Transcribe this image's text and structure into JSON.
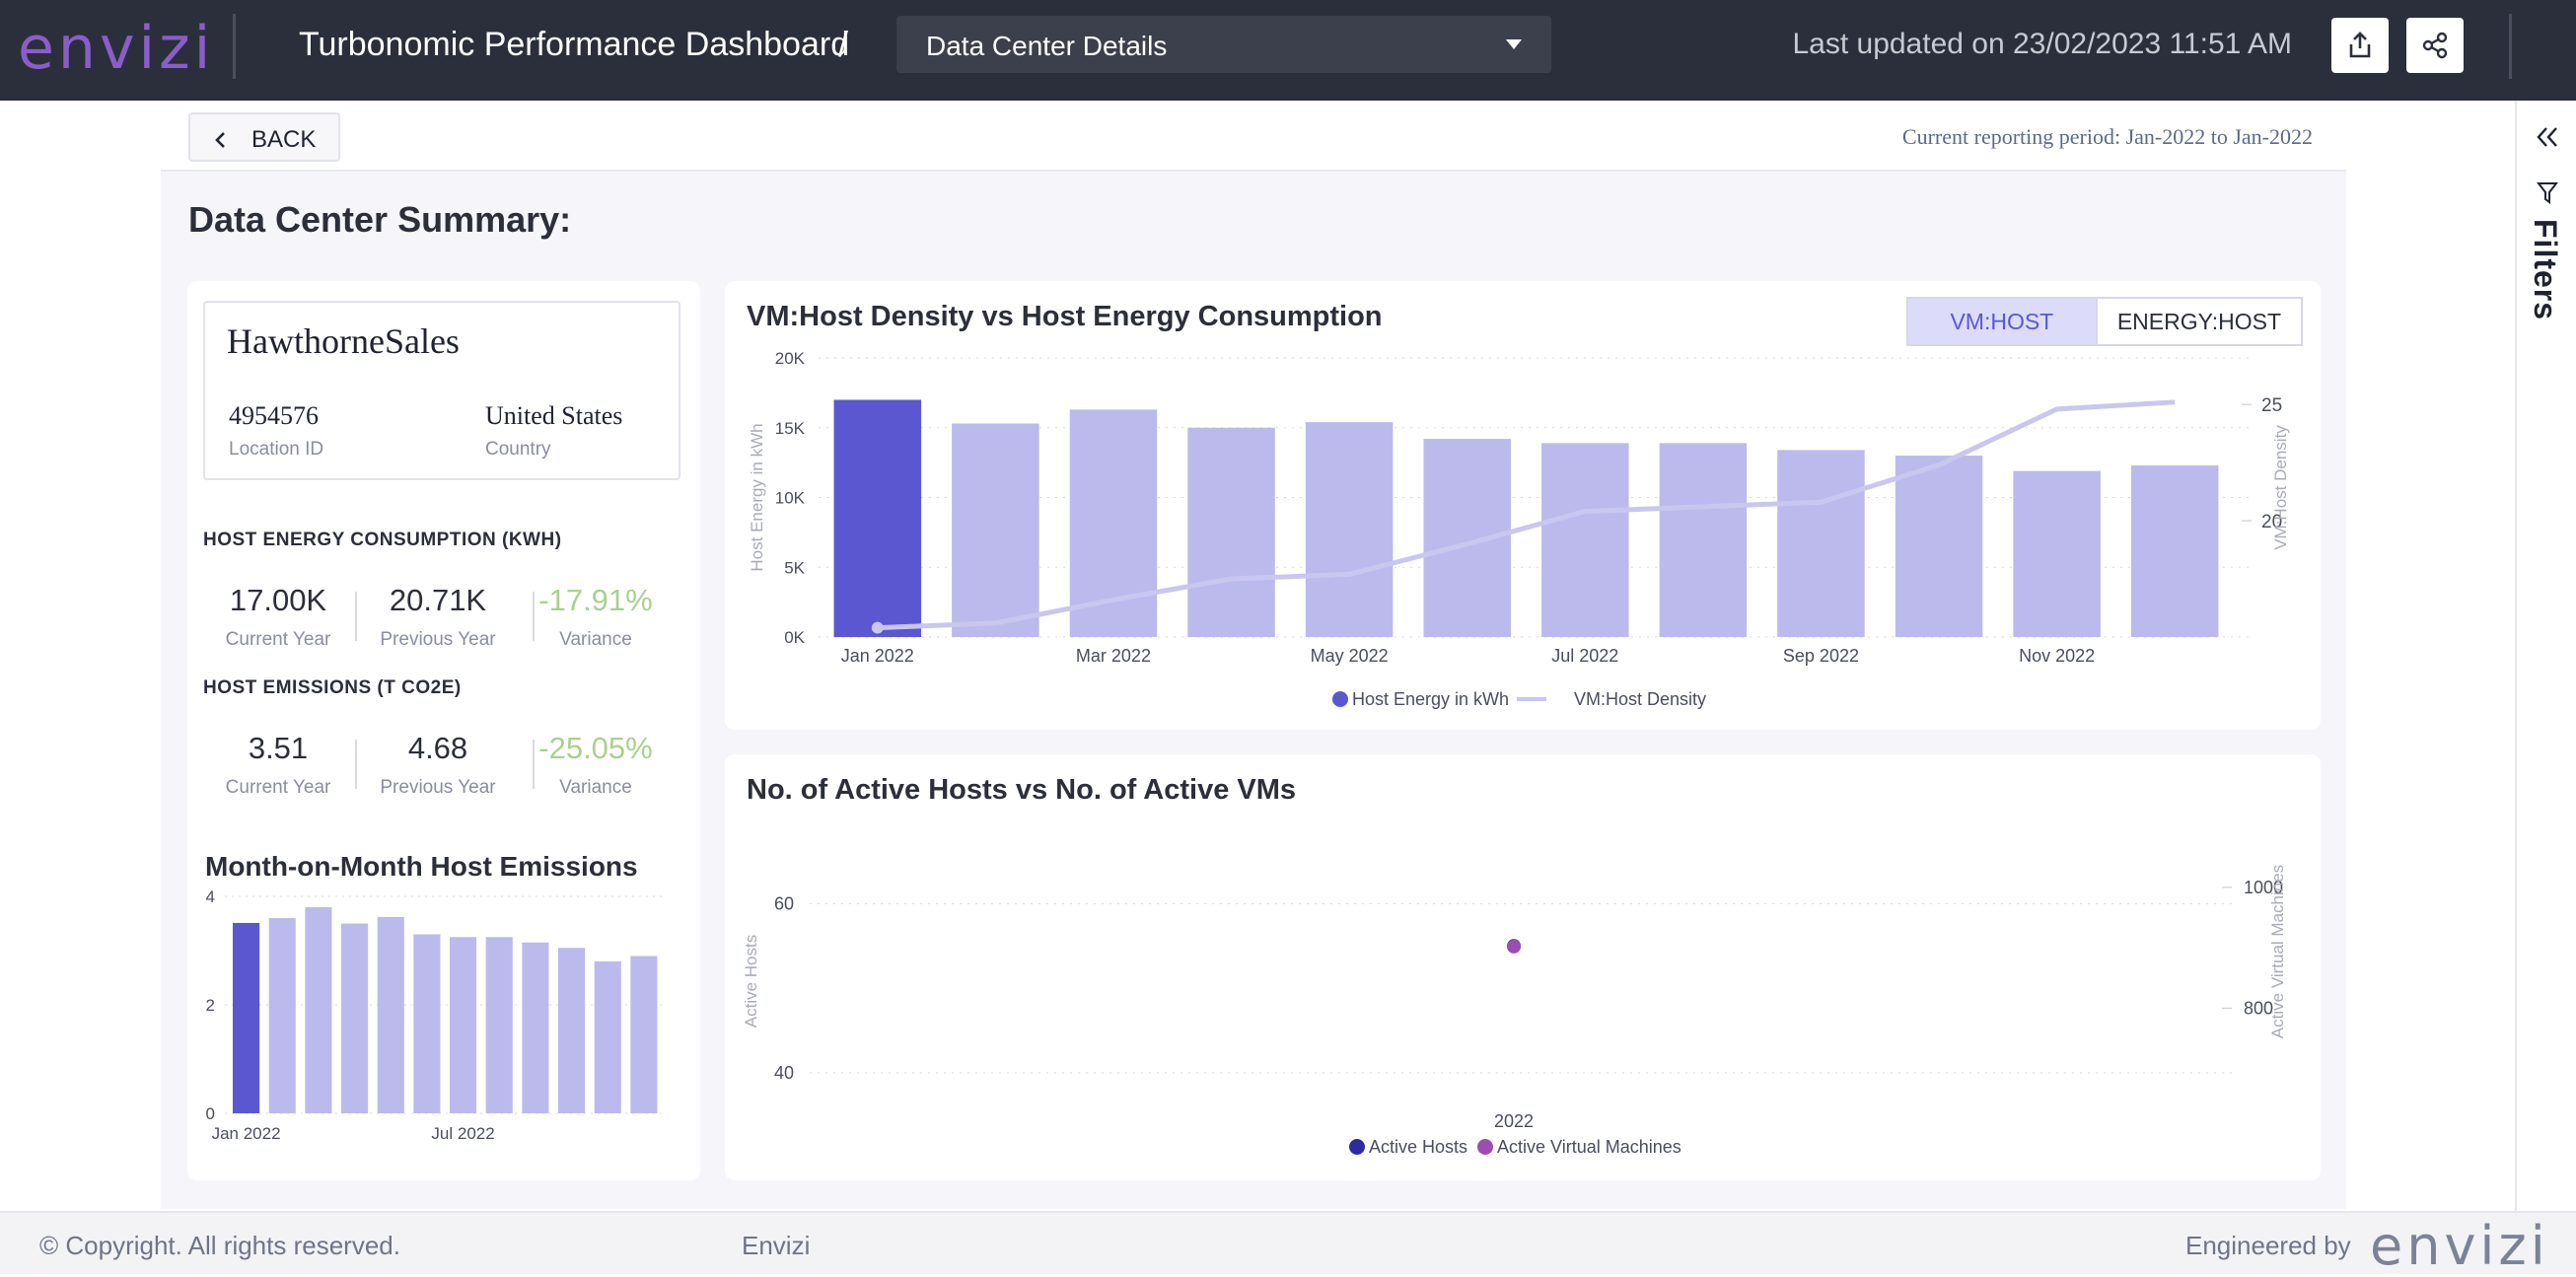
{
  "header": {
    "logo": "envizi",
    "app_title": "Turbonomic Performance Dashboard",
    "separator": "/",
    "dropdown_value": "Data Center Details",
    "last_updated": "Last updated on 23/02/2023 11:51 AM",
    "actions": [
      "export-icon",
      "share-icon"
    ]
  },
  "toolbar": {
    "back_label": "BACK",
    "reporting_period": "Current reporting period: Jan-2022 to Jan-2022"
  },
  "filters": {
    "label": "Filters",
    "icons": [
      "double-chevron-left-icon",
      "funnel-icon"
    ]
  },
  "page": {
    "section_title": "Data Center Summary:"
  },
  "location": {
    "name": "HawthorneSales",
    "id_value": "4954576",
    "id_label": "Location ID",
    "country_value": "United States",
    "country_label": "Country"
  },
  "kpis": {
    "energy": {
      "title": "HOST ENERGY CONSUMPTION (KWH)",
      "current": "17.00K",
      "current_label": "Current Year",
      "previous": "20.71K",
      "previous_label": "Previous Year",
      "variance": "-17.91%",
      "variance_label": "Variance"
    },
    "emissions": {
      "title": "HOST EMISSIONS (T CO2E)",
      "current": "3.51",
      "current_label": "Current Year",
      "previous": "4.68",
      "previous_label": "Previous Year",
      "variance": "-25.05%",
      "variance_label": "Variance"
    },
    "variance_color": "#a9d18e"
  },
  "toggle": {
    "active": "VM:HOST",
    "inactive": "ENERGY:HOST"
  },
  "colors": {
    "highlight": "#5b57d1",
    "bar": "#bcbaec",
    "line": "#c9c7f0",
    "hosts": "#2f2aa0",
    "vms": "#9a4fb0"
  },
  "chart_data": [
    {
      "type": "bar",
      "title": "Month-on-Month Host Emissions",
      "categories": [
        "Jan 2022",
        "Feb 2022",
        "Mar 2022",
        "Apr 2022",
        "May 2022",
        "Jun 2022",
        "Jul 2022",
        "Aug 2022",
        "Sep 2022",
        "Oct 2022",
        "Nov 2022",
        "Dec 2022"
      ],
      "values": [
        3.51,
        3.6,
        3.8,
        3.5,
        3.62,
        3.3,
        3.25,
        3.25,
        3.15,
        3.05,
        2.8,
        2.9
      ],
      "highlight_index": 0,
      "x_tick_labels": [
        "Jan 2022",
        "Jul 2022"
      ],
      "ylim": [
        0,
        4
      ],
      "y_ticks": [
        0,
        2,
        4
      ],
      "grid": true
    },
    {
      "type": "bar",
      "title": "VM:Host Density vs Host Energy Consumption",
      "categories": [
        "Jan 2022",
        "Feb 2022",
        "Mar 2022",
        "Apr 2022",
        "May 2022",
        "Jun 2022",
        "Jul 2022",
        "Aug 2022",
        "Sep 2022",
        "Oct 2022",
        "Nov 2022",
        "Dec 2022"
      ],
      "x_tick_labels": [
        "Jan 2022",
        "Mar 2022",
        "May 2022",
        "Jul 2022",
        "Sep 2022",
        "Nov 2022"
      ],
      "series": [
        {
          "name": "Host Energy in kWh",
          "type": "bar",
          "axis": "left",
          "values": [
            17000,
            15300,
            16300,
            15000,
            15400,
            14200,
            13900,
            13900,
            13400,
            13000,
            11900,
            12300
          ]
        },
        {
          "name": "VM:Host Density",
          "type": "line",
          "axis": "right",
          "values": [
            15.4,
            15.6,
            16.6,
            17.5,
            17.7,
            19.0,
            20.4,
            20.6,
            20.8,
            22.4,
            24.8,
            25.1
          ]
        }
      ],
      "ylabel": "Host Energy in kWh",
      "y2label": "VM:Host Density",
      "ylim": [
        0,
        20000
      ],
      "y_ticks": [
        0,
        5000,
        10000,
        15000,
        20000
      ],
      "y_tick_labels": [
        "0K",
        "5K",
        "10K",
        "15K",
        "20K"
      ],
      "y2lim": [
        15,
        27
      ],
      "y2_ticks": [
        20,
        25
      ],
      "highlight_index": 0,
      "legend": "bottom",
      "grid": true
    },
    {
      "type": "scatter",
      "title": "No. of Active Hosts vs No. of Active VMs",
      "x": [
        "2022"
      ],
      "series": [
        {
          "name": "Active Hosts",
          "axis": "left",
          "values": [
            55
          ]
        },
        {
          "name": "Active Virtual Machines",
          "axis": "right",
          "values": [
            902
          ]
        }
      ],
      "ylabel": "Active Hosts",
      "y2label": "Active Virtual Machines",
      "ylim": [
        38,
        66
      ],
      "y_ticks": [
        40,
        60
      ],
      "y2lim": [
        665,
        1057
      ],
      "y2_ticks": [
        800,
        1000
      ],
      "legend": "bottom",
      "grid": true
    }
  ],
  "footer": {
    "copyright": "© Copyright. All rights reserved.",
    "brand": "Envizi",
    "engineered_by": "Engineered by",
    "logo": "envizi"
  }
}
